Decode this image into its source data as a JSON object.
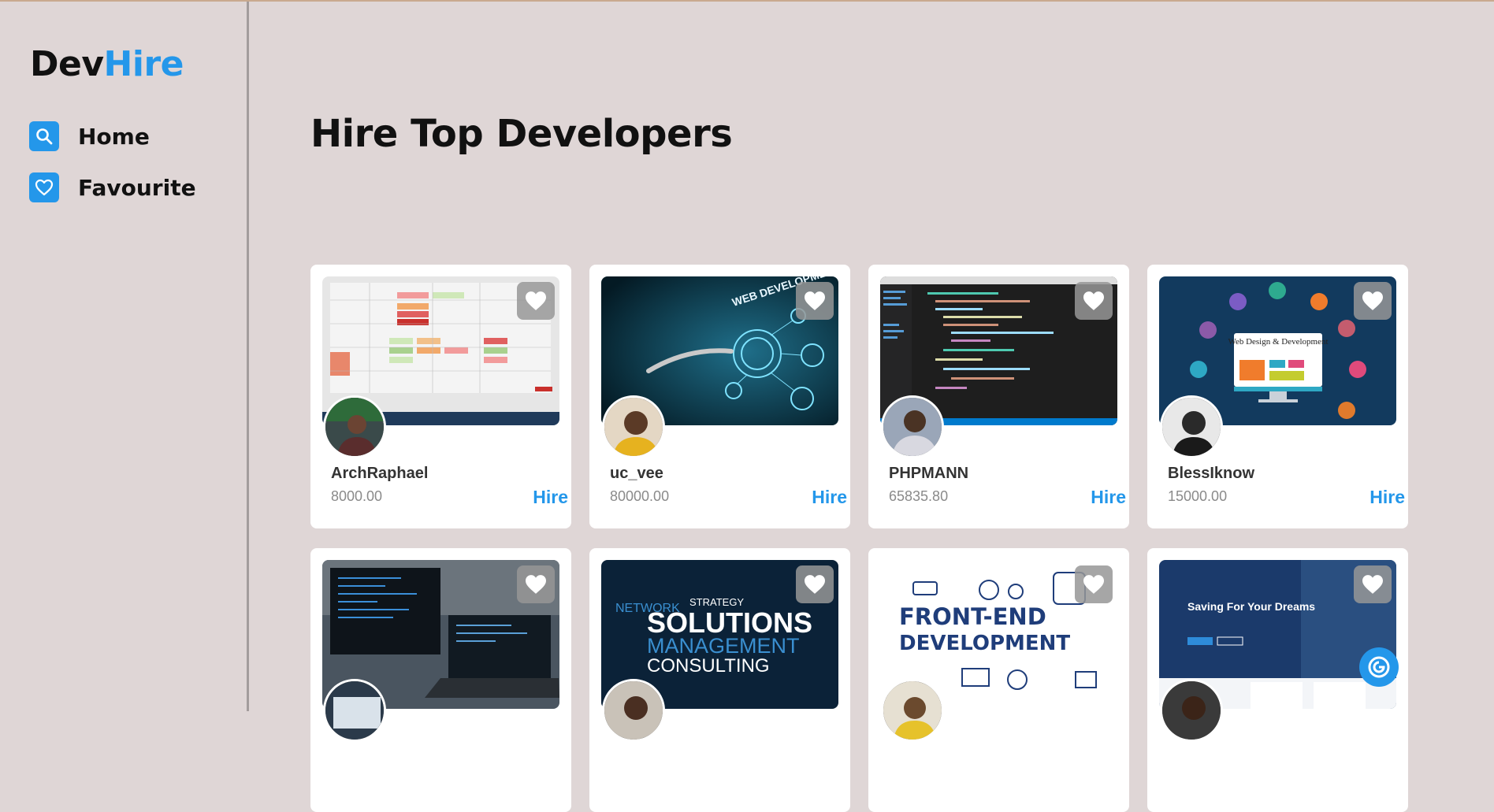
{
  "brand": {
    "part1": "Dev",
    "part2": "Hire",
    "accent": "#2497ea"
  },
  "sidebar": {
    "items": [
      {
        "label": "Home",
        "icon": "search-icon"
      },
      {
        "label": "Favourite",
        "icon": "heart-icon"
      }
    ]
  },
  "main": {
    "title": "Hire Top Developers"
  },
  "developers": [
    {
      "name": "ArchRaphael",
      "price": "8000.00",
      "hire_label": "Hire"
    },
    {
      "name": "uc_vee",
      "price": "80000.00",
      "hire_label": "Hire"
    },
    {
      "name": "PHPMANN",
      "price": "65835.80",
      "hire_label": "Hire"
    },
    {
      "name": "BlessIknow",
      "price": "15000.00",
      "hire_label": "Hire"
    }
  ],
  "thumbnail_text": {
    "web_dev": "WEB DEVELOPMENT",
    "web_design": "Web Design & Development",
    "solutions": "SOLUTIONS",
    "management": "MANAGEMENT",
    "consulting": "CONSULTING",
    "strategy": "STRATEGY",
    "network": "NETWORK",
    "frontend": "FRONT-END",
    "development": "DEVELOPMENT",
    "saving": "Saving For Your Dreams"
  }
}
